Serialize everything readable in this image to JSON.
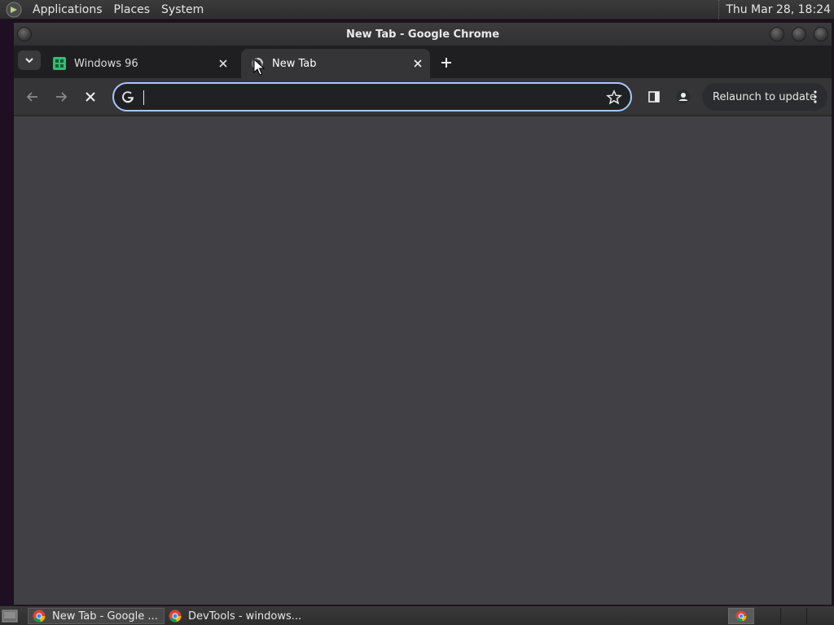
{
  "top_panel": {
    "menus": [
      "Applications",
      "Places",
      "System"
    ],
    "clock": "Thu Mar 28, 18:24"
  },
  "window": {
    "title": "New Tab - Google Chrome"
  },
  "tabs": [
    {
      "title": "Windows 96",
      "icon": "windows96-icon",
      "active": false
    },
    {
      "title": "New Tab",
      "icon": "loading-spinner-icon",
      "active": true
    }
  ],
  "toolbar": {
    "omnibox_value": "",
    "relaunch_label": "Relaunch to update"
  },
  "taskbar": {
    "items": [
      {
        "label": "New Tab - Google ...",
        "icon": "chrome-icon",
        "active": true
      },
      {
        "label": "DevTools - windows...",
        "icon": "chrome-icon",
        "active": false
      }
    ]
  },
  "colors": {
    "accent_focus": "#a8c7fa",
    "content_bg": "#414145",
    "toolbar_bg": "#353538",
    "tabstrip_bg": "#1f1f21",
    "windows96_green": "#2fbf71"
  }
}
